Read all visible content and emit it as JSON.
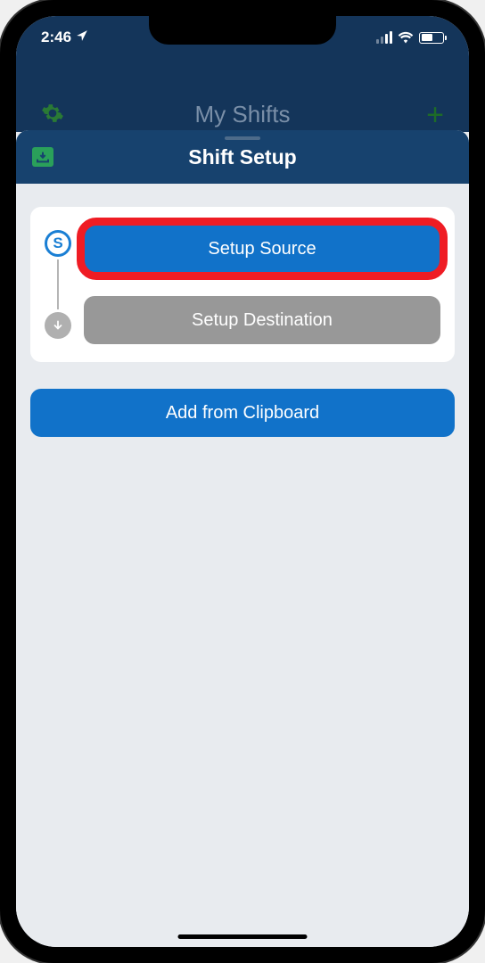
{
  "status_bar": {
    "time": "2:46",
    "location_icon": "◤"
  },
  "background": {
    "title": "My Shifts"
  },
  "sheet": {
    "title": "Shift Setup"
  },
  "flow": {
    "source_indicator": "S",
    "dest_indicator": "↓"
  },
  "buttons": {
    "setup_source": "Setup Source",
    "setup_destination": "Setup Destination",
    "add_clipboard": "Add from Clipboard"
  }
}
